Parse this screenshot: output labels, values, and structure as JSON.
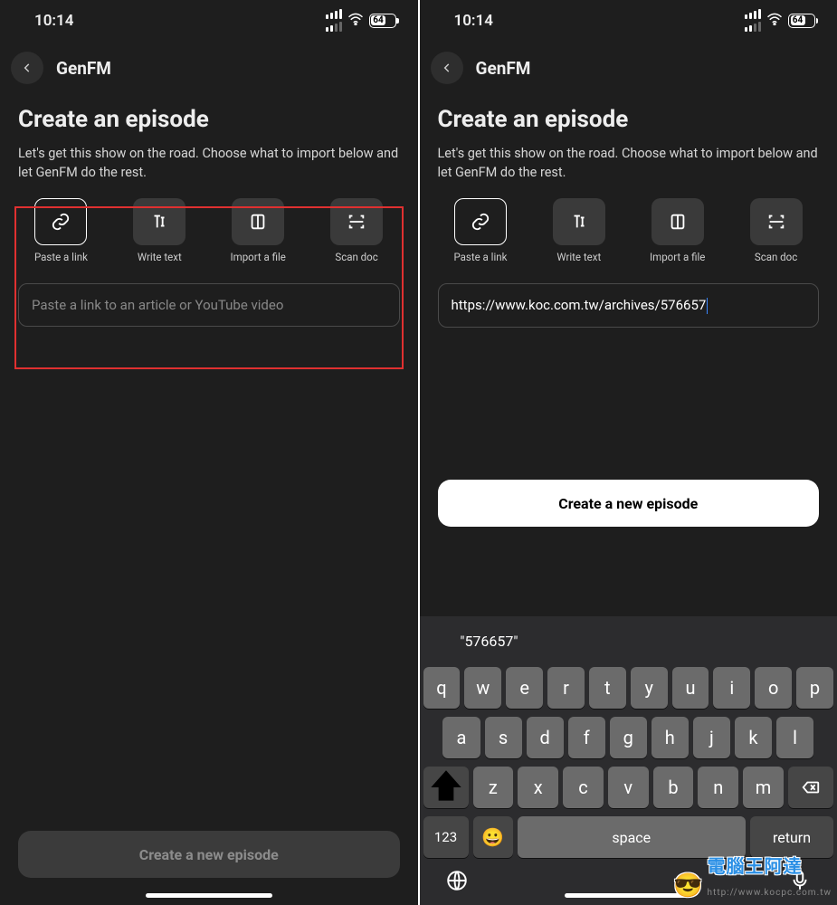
{
  "status": {
    "time": "10:14",
    "battery_pct": 64
  },
  "nav": {
    "title": "GenFM"
  },
  "page": {
    "heading": "Create an episode",
    "subtitle": "Let's get this show on the road. Choose what to import below and let GenFM do the rest."
  },
  "options": {
    "paste_link": "Paste a link",
    "write_text": "Write text",
    "import_file": "Import a file",
    "scan_doc": "Scan doc"
  },
  "input": {
    "placeholder": "Paste a link to an article or YouTube video",
    "value": "https://www.koc.com.tw/archives/576657"
  },
  "cta": {
    "label": "Create a new episode"
  },
  "keyboard": {
    "prediction": "\"576657\"",
    "row1": [
      "q",
      "w",
      "e",
      "r",
      "t",
      "y",
      "u",
      "i",
      "o",
      "p"
    ],
    "row2": [
      "a",
      "s",
      "d",
      "f",
      "g",
      "h",
      "j",
      "k",
      "l"
    ],
    "row3": [
      "z",
      "x",
      "c",
      "v",
      "b",
      "n",
      "m"
    ],
    "mode": "123",
    "space": "space",
    "return": "return"
  },
  "watermark": {
    "text": "電腦王阿達",
    "url": "http://www.kocpc.com.tw"
  }
}
